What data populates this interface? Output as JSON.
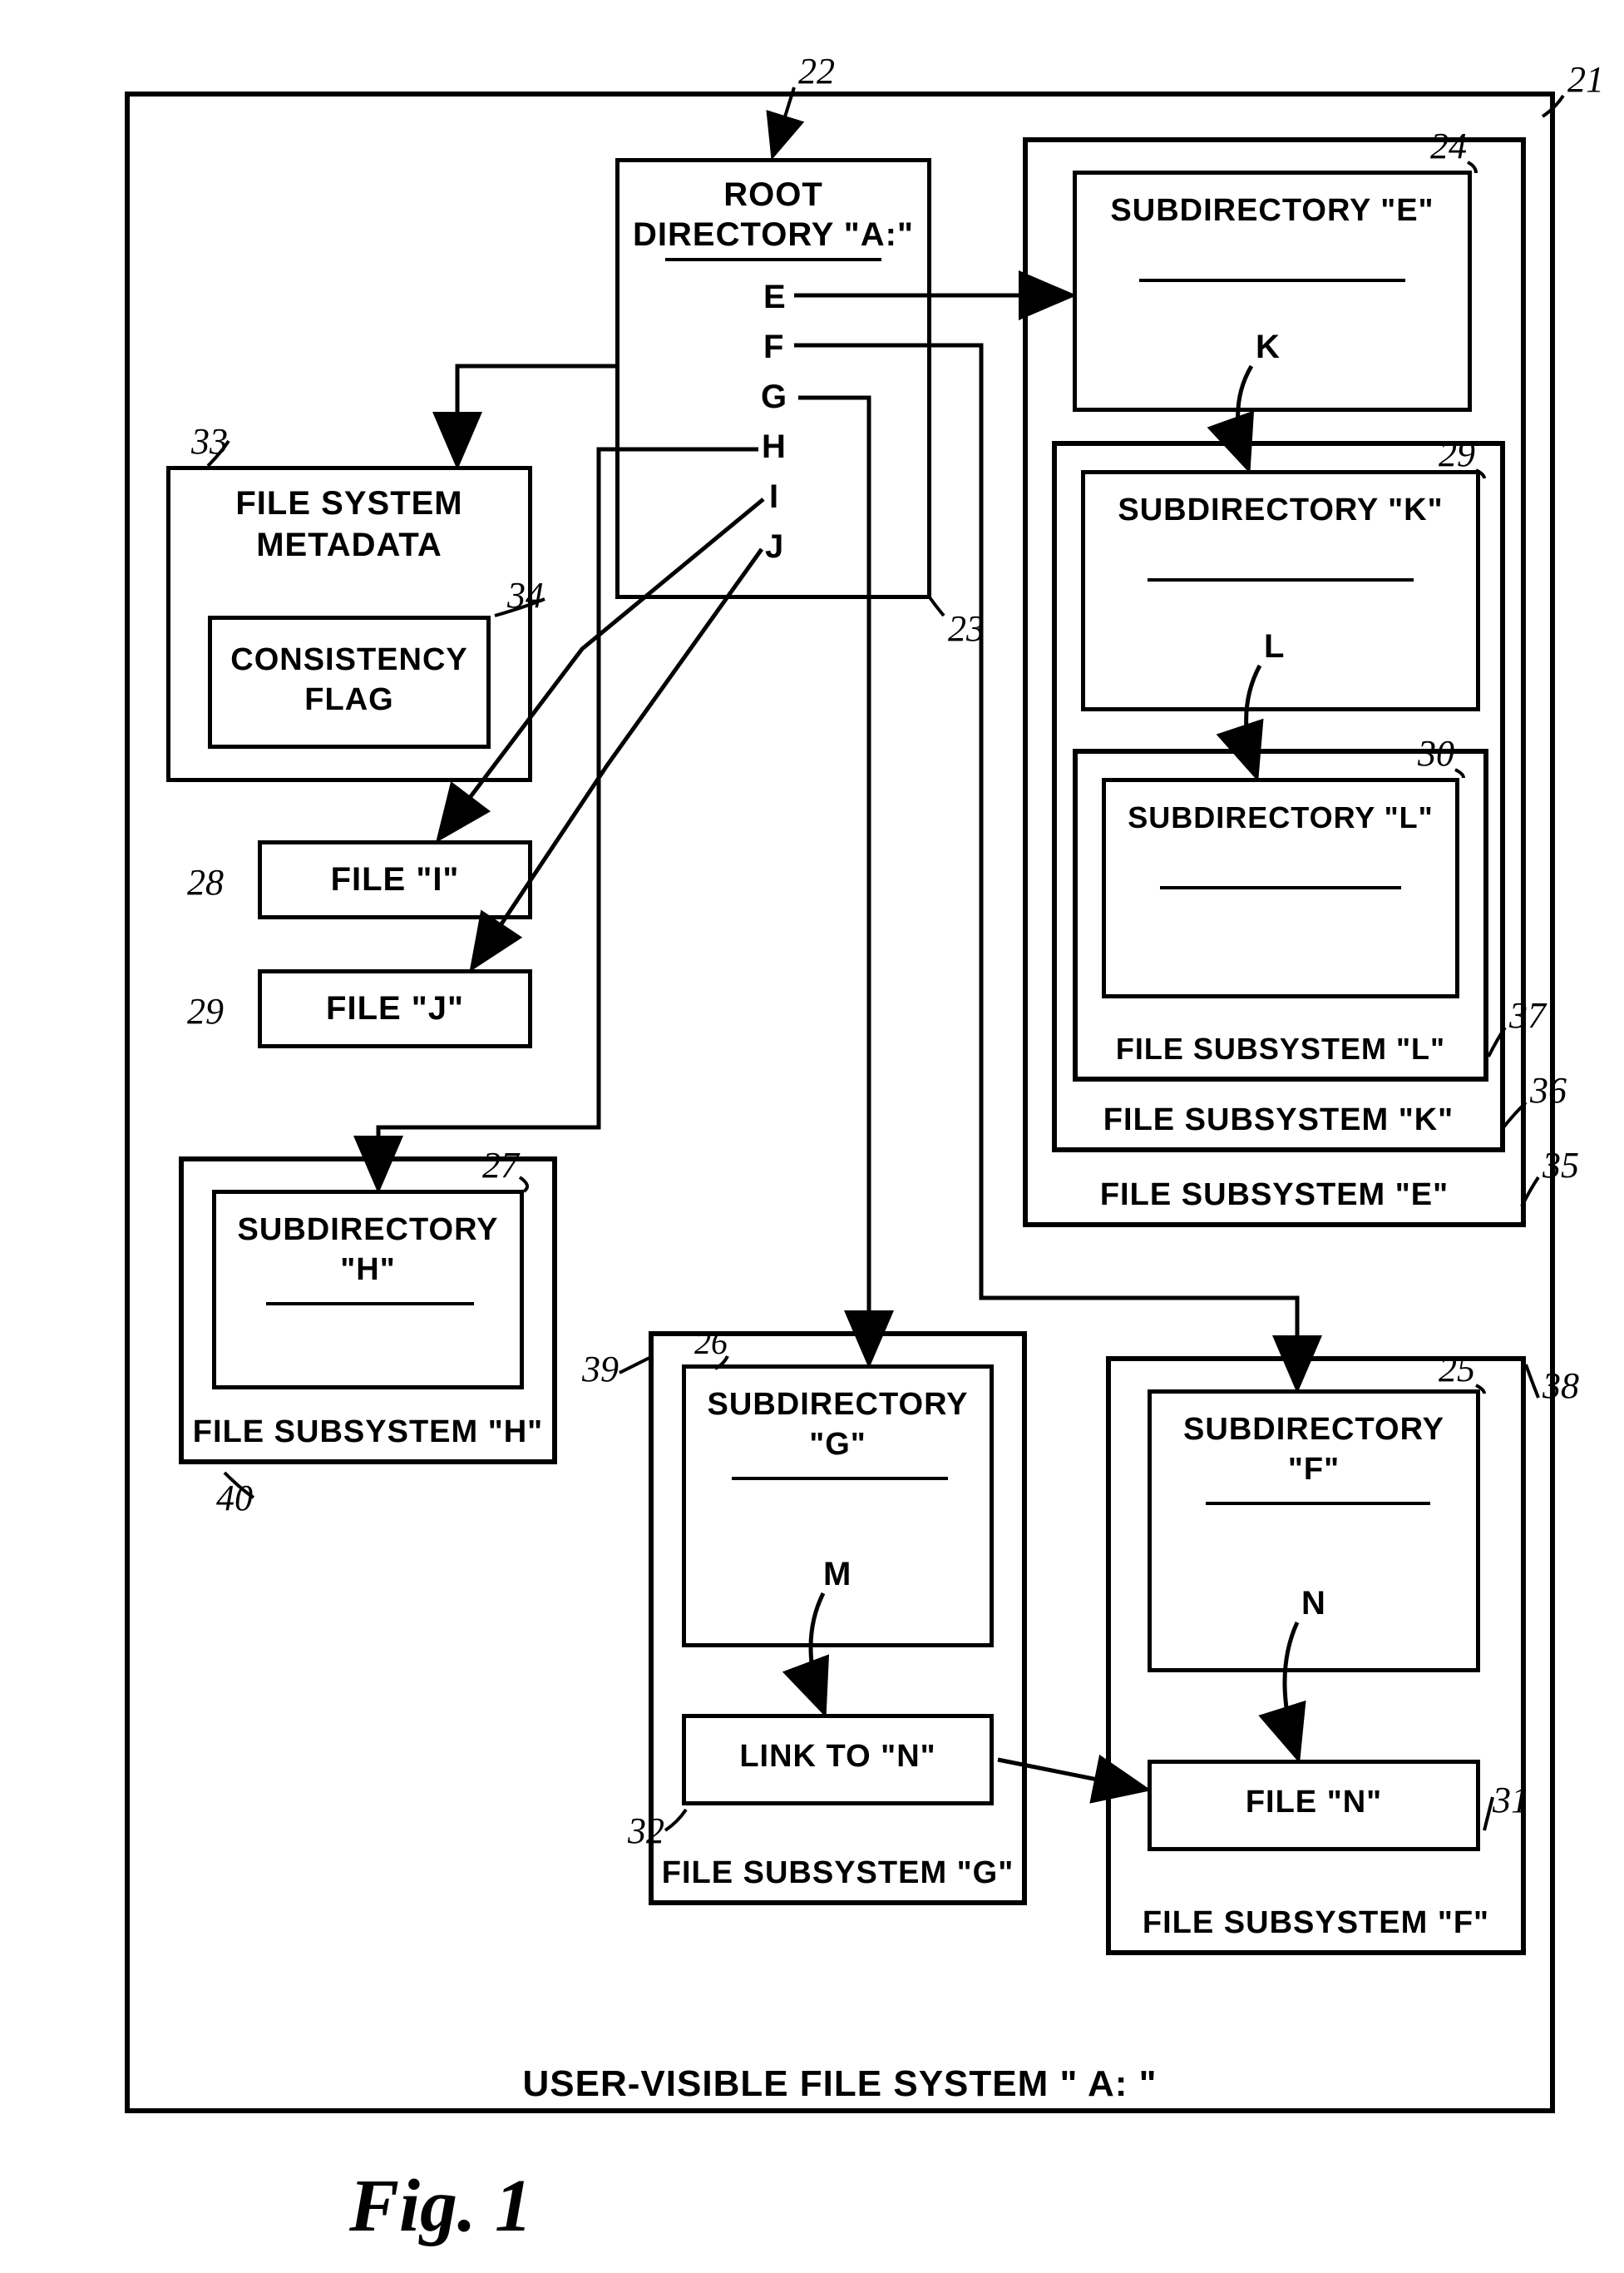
{
  "figure_label": "Fig. 1",
  "outer": {
    "title": "USER-VISIBLE FILE SYSTEM \" A: \"",
    "ref": "21"
  },
  "root": {
    "title": "ROOT DIRECTORY \"A:\"",
    "entries": [
      "E",
      "F",
      "G",
      "H",
      "I",
      "J"
    ],
    "ref_top": "22",
    "ref_side": "23"
  },
  "metadata": {
    "title": "FILE SYSTEM METADATA",
    "ref": "33",
    "flag": "CONSISTENCY FLAG",
    "flag_ref": "34"
  },
  "file_i": {
    "label": "FILE \"I\"",
    "ref": "28"
  },
  "file_j": {
    "label": "FILE \"J\"",
    "ref": "29"
  },
  "sub_e": {
    "outer_label": "FILE SUBSYSTEM \"E\"",
    "outer_ref": "35",
    "dir": "SUBDIRECTORY \"E\"",
    "dir_ref": "24",
    "entry": "K",
    "sub_k": {
      "outer_label": "FILE SUBSYSTEM \"K\"",
      "outer_ref": "36",
      "dir": "SUBDIRECTORY \"K\"",
      "dir_ref": "29",
      "entry": "L",
      "sub_l": {
        "outer_label": "FILE SUBSYSTEM \"L\"",
        "outer_ref": "37",
        "dir": "SUBDIRECTORY \"L\"",
        "dir_ref": "30"
      }
    }
  },
  "sub_f": {
    "outer_label": "FILE SUBSYSTEM \"F\"",
    "outer_ref": "38",
    "dir": "SUBDIRECTORY \"F\"",
    "dir_ref": "25",
    "entry": "N",
    "file": "FILE \"N\"",
    "file_ref": "31"
  },
  "sub_g": {
    "outer_label": "FILE SUBSYSTEM \"G\"",
    "outer_ref": "39",
    "dir": "SUBDIRECTORY \"G\"",
    "dir_ref": "26",
    "entry": "M",
    "link": "LINK TO \"N\"",
    "link_ref": "32"
  },
  "sub_h": {
    "outer_label": "FILE SUBSYSTEM \"H\"",
    "outer_ref": "40",
    "dir": "SUBDIRECTORY \"H\"",
    "dir_ref": "27"
  }
}
